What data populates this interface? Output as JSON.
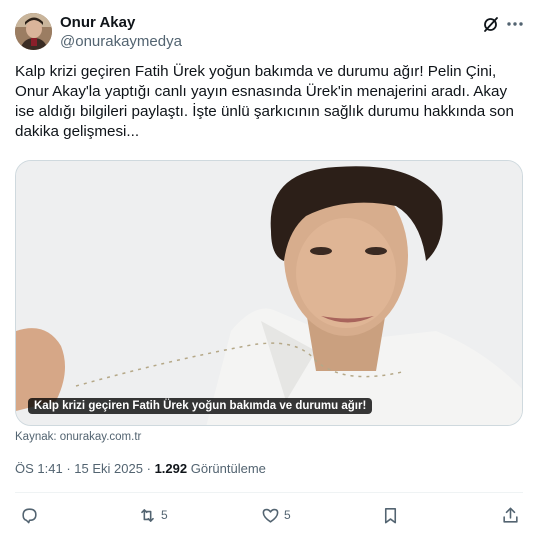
{
  "author": {
    "name": "Onur Akay",
    "handle": "@onurakaymedya"
  },
  "tweet": {
    "text": "Kalp krizi geçiren Fatih Ürek yoğun bakımda ve durumu ağır! Pelin Çini, Onur Akay'la yaptığı canlı yayın esnasında Ürek'in menajerini aradı. Akay ise aldığı bilgileri paylaştı. İşte ünlü şarkıcının sağlık durumu hakkında son dakika gelişmesi...",
    "media_caption": "Kalp krizi geçiren Fatih Ürek yoğun bakımda ve durumu ağır!",
    "source": "Kaynak: onurakay.com.tr",
    "time": "ÖS 1:41",
    "date": "15 Eki 2025",
    "views_count": "1.292",
    "views_label": "Görüntüleme",
    "separator": "·"
  },
  "actions": {
    "reply_count": "",
    "retweet_count": "5",
    "like_count": "5"
  },
  "icons": {
    "grok": "grok-icon",
    "more": "more-icon",
    "reply": "reply-icon",
    "retweet": "retweet-icon",
    "like": "heart-icon",
    "bookmark": "bookmark-icon",
    "share": "share-icon"
  },
  "colors": {
    "text": "#0f1419",
    "secondary": "#536471",
    "border": "#cfd9de"
  }
}
